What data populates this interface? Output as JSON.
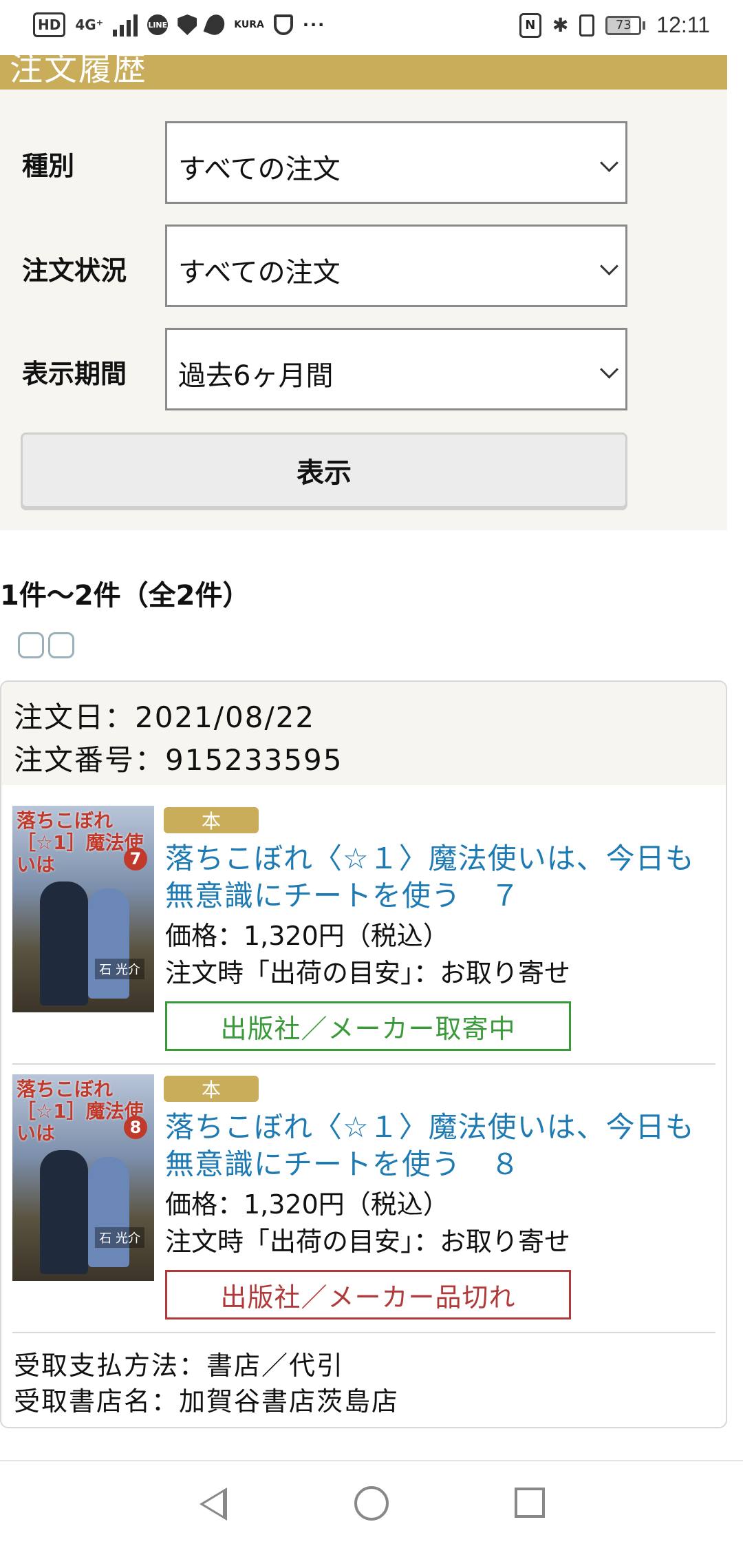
{
  "status_bar": {
    "left_icons": [
      "hd-icon",
      "4g-signal-icon",
      "line-icon",
      "shield-icon",
      "carrot-icon",
      "kura-icon",
      "shield-outline-icon",
      "more-icon"
    ],
    "hd_label": "HD",
    "network_label": "4G⁺",
    "line_label": "LINE",
    "kura_label": "KURA",
    "more_label": "···",
    "battery_level": "73",
    "time": "12:11"
  },
  "header": {
    "title": "注文履歴",
    "accent_color": "#c9ad5a"
  },
  "filters": {
    "type": {
      "label": "種別",
      "value": "すべての注文"
    },
    "status": {
      "label": "注文状況",
      "value": "すべての注文"
    },
    "period": {
      "label": "表示期間",
      "value": "過去6ヶ月間"
    },
    "submit_label": "表示"
  },
  "results": {
    "count_text": "1件〜2件（全2件）"
  },
  "order": {
    "date_line": "注文日：2021/08/22",
    "number_line": "注文番号：915233595",
    "items": [
      {
        "badge": "本",
        "title": "落ちこぼれ〈☆１〉魔法使いは、今日も無意識にチートを使う　７",
        "price": "価格：1,320円（税込）",
        "ship": "注文時「出荷の目安」：お取り寄せ",
        "status": "出版社／メーカー取寄中",
        "status_color": "#3a9a3a",
        "cover_title": "落ちこぼれ［☆1］魔法使いは",
        "cover_vol": "7",
        "cover_author": "石 光介"
      },
      {
        "badge": "本",
        "title": "落ちこぼれ〈☆１〉魔法使いは、今日も無意識にチートを使う　８",
        "price": "価格：1,320円（税込）",
        "ship": "注文時「出荷の目安」：お取り寄せ",
        "status": "出版社／メーカー品切れ",
        "status_color": "#b03a3a",
        "cover_title": "落ちこぼれ［☆1］魔法使いは",
        "cover_vol": "8",
        "cover_author": "石 光介"
      }
    ],
    "payment_line": "受取支払方法：書店／代引",
    "store_line": "受取書店名：加賀谷書店茨島店"
  },
  "navbar": {
    "icons": [
      "back-icon",
      "home-icon",
      "recent-apps-icon"
    ]
  }
}
